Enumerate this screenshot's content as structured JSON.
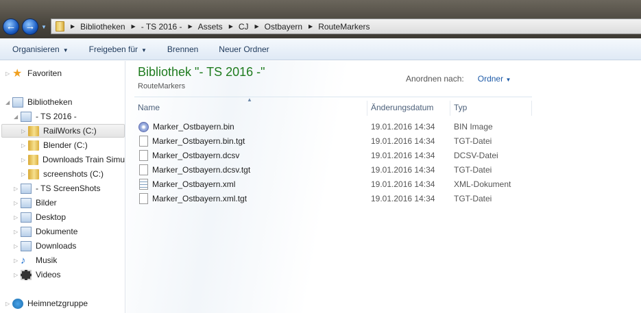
{
  "nav": {
    "back_icon": "arrow-left-icon",
    "forward_icon": "arrow-right-icon"
  },
  "address": {
    "crumbs": [
      "Bibliotheken",
      "- TS 2016 -",
      "Assets",
      "CJ",
      "Ostbayern",
      "RouteMarkers"
    ]
  },
  "toolbar": {
    "organize": "Organisieren",
    "share": "Freigeben für",
    "burn": "Brennen",
    "new_folder": "Neuer Ordner"
  },
  "sidebar": {
    "items": [
      {
        "label": "Favoriten",
        "icon": "star-icon"
      },
      {
        "label": "Bibliotheken",
        "icon": "library-icon"
      },
      {
        "label": "- TS 2016 -",
        "icon": "library-icon"
      },
      {
        "label": "RailWorks (C:)",
        "icon": "folder-icon"
      },
      {
        "label": "Blender (C:)",
        "icon": "folder-icon"
      },
      {
        "label": "Downloads Train Simu",
        "icon": "folder-icon"
      },
      {
        "label": "screenshots (C:)",
        "icon": "folder-icon"
      },
      {
        "label": "- TS ScreenShots",
        "icon": "library-icon"
      },
      {
        "label": "Bilder",
        "icon": "library-icon"
      },
      {
        "label": "Desktop",
        "icon": "library-icon"
      },
      {
        "label": "Dokumente",
        "icon": "library-icon"
      },
      {
        "label": "Downloads",
        "icon": "library-icon"
      },
      {
        "label": "Musik",
        "icon": "library-icon"
      },
      {
        "label": "Videos",
        "icon": "library-icon"
      },
      {
        "label": "Heimnetzgruppe",
        "icon": "network-icon"
      }
    ]
  },
  "main": {
    "title": "Bibliothek \"- TS 2016 -\"",
    "subtitle": "RouteMarkers",
    "arrange_label": "Anordnen nach:",
    "arrange_value": "Ordner",
    "columns": [
      "Name",
      "Änderungsdatum",
      "Typ"
    ],
    "files": [
      {
        "name": "Marker_Ostbayern.bin",
        "date": "19.01.2016 14:34",
        "type": "BIN Image"
      },
      {
        "name": "Marker_Ostbayern.bin.tgt",
        "date": "19.01.2016 14:34",
        "type": "TGT-Datei"
      },
      {
        "name": "Marker_Ostbayern.dcsv",
        "date": "19.01.2016 14:34",
        "type": "DCSV-Datei"
      },
      {
        "name": "Marker_Ostbayern.dcsv.tgt",
        "date": "19.01.2016 14:34",
        "type": "TGT-Datei"
      },
      {
        "name": "Marker_Ostbayern.xml",
        "date": "19.01.2016 14:34",
        "type": "XML-Dokument"
      },
      {
        "name": "Marker_Ostbayern.xml.tgt",
        "date": "19.01.2016 14:34",
        "type": "TGT-Datei"
      }
    ]
  }
}
